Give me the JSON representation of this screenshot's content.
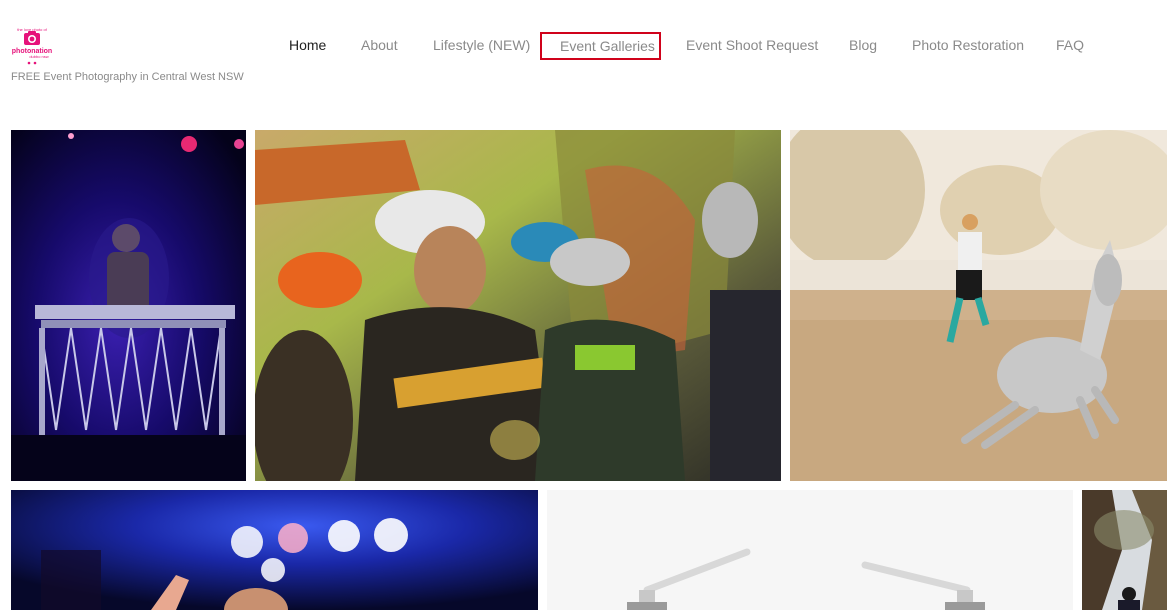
{
  "site": {
    "logo_text_top": "the love photo of",
    "logo_text_main": "photonation",
    "logo_text_sub": "dubbo nsw",
    "tagline": "FREE Event Photography in Central West NSW",
    "accent_color": "#e6127a"
  },
  "nav": {
    "items": [
      {
        "label": "Home",
        "active": true
      },
      {
        "label": "About"
      },
      {
        "label": "Lifestyle (NEW)"
      },
      {
        "label": "Event Galleries",
        "highlighted": true
      },
      {
        "label": "Event Shoot Request"
      },
      {
        "label": "Blog"
      },
      {
        "label": "Photo Restoration"
      },
      {
        "label": "FAQ"
      }
    ],
    "highlight_color": "#d0021b"
  },
  "gallery": {
    "tiles": [
      {
        "subject": "dj-stage-photo"
      },
      {
        "subject": "cyclists-photo"
      },
      {
        "subject": "running-horse-photo"
      },
      {
        "subject": "concert-dancer-photo"
      },
      {
        "subject": "drone-photo"
      },
      {
        "subject": "outdoor-event-photo"
      }
    ]
  }
}
